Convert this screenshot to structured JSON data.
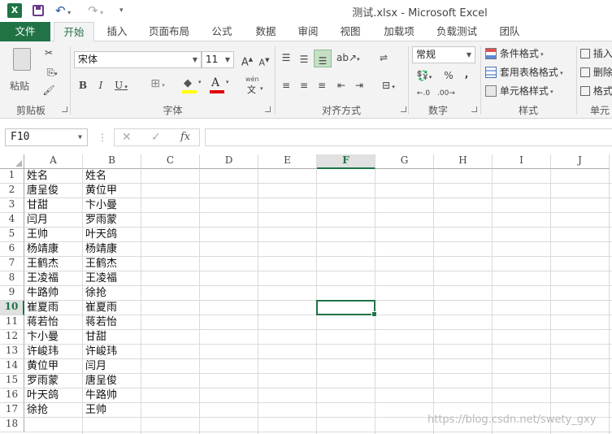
{
  "window": {
    "title": "测试.xlsx - Microsoft Excel",
    "logo": "X"
  },
  "quick_access": {
    "icons": [
      "save-icon",
      "undo-icon",
      "redo-icon",
      "customize-icon"
    ]
  },
  "ribbon_tabs": [
    "文件",
    "开始",
    "插入",
    "页面布局",
    "公式",
    "数据",
    "审阅",
    "视图",
    "加载项",
    "负载测试",
    "团队"
  ],
  "active_tab": "开始",
  "ribbon": {
    "clipboard": {
      "label": "剪贴板",
      "paste": "粘贴"
    },
    "font": {
      "label": "字体",
      "name": "宋体",
      "size": "11",
      "wen": "wén",
      "wen_char": "文"
    },
    "alignment": {
      "label": "对齐方式"
    },
    "number": {
      "label": "数字",
      "format": "常规"
    },
    "styles": {
      "label": "样式",
      "conditional": "条件格式",
      "table": "套用表格格式",
      "cell": "单元格样式"
    },
    "cells": {
      "label": "单元",
      "insert": "插入",
      "delete": "删除",
      "format": "格式"
    }
  },
  "formula_bar": {
    "name_box": "F10",
    "fx": "fx",
    "value": ""
  },
  "sheet": {
    "columns": [
      "A",
      "B",
      "C",
      "D",
      "E",
      "F",
      "G",
      "H",
      "I",
      "J"
    ],
    "selected_column": "F",
    "selected_row": 10,
    "row_numbers": [
      "1",
      "2",
      "3",
      "4",
      "5",
      "6",
      "7",
      "8",
      "9",
      "10",
      "11",
      "12",
      "13",
      "14",
      "15",
      "16",
      "17",
      "18"
    ],
    "col_a": [
      "姓名",
      "唐呈俊",
      "甘甜",
      "闫月",
      "王帅",
      "杨靖康",
      "王鹤杰",
      "王凌福",
      "牛路帅",
      "崔夏雨",
      "蒋若怡",
      "卞小曼",
      "许峻玮",
      "黄位甲",
      "罗雨蒙",
      "叶天鸽",
      "徐抢",
      ""
    ],
    "col_b": [
      "姓名",
      "黄位甲",
      "卞小曼",
      "罗雨蒙",
      "叶天鸽",
      "杨靖康",
      "王鹤杰",
      "王凌福",
      "徐抢",
      "崔夏雨",
      "蒋若怡",
      "甘甜",
      "许峻玮",
      "闫月",
      "唐呈俊",
      "牛路帅",
      "王帅",
      ""
    ]
  },
  "watermark": "https://blog.csdn.net/swety_gxy",
  "colors": {
    "accent": "#217346",
    "grid": "#dadada",
    "ribbon_bg": "#f3f3f3"
  }
}
